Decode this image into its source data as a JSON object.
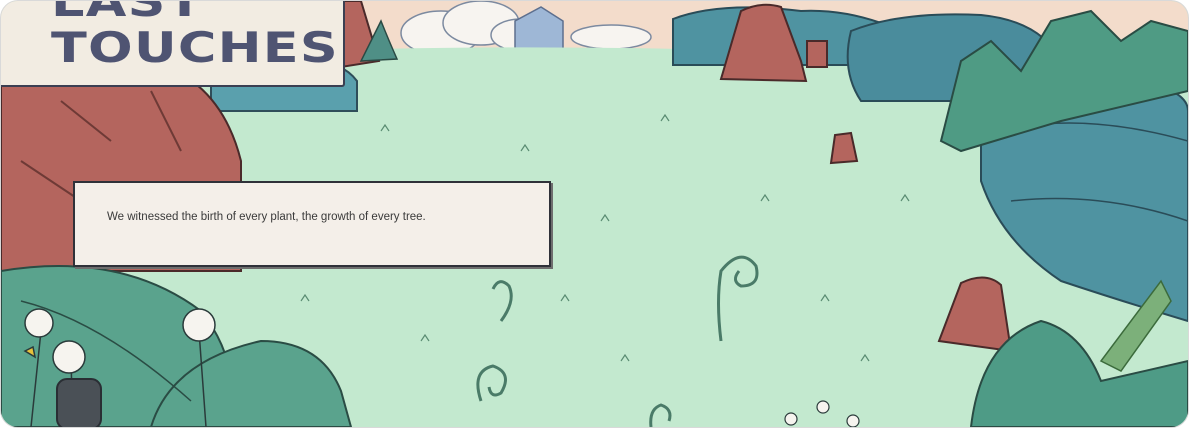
{
  "game": {
    "title_line_1": "LAST",
    "title_line_2": "TOUCHES"
  },
  "dialog": {
    "text": "We witnessed the birth of every plant, the growth of every tree."
  },
  "colors": {
    "grass": "#bfe6cc",
    "title_ink": "#4f5472",
    "rock": "#b4655e",
    "bush": "#4f93a1",
    "panel": "#f4efe9"
  }
}
